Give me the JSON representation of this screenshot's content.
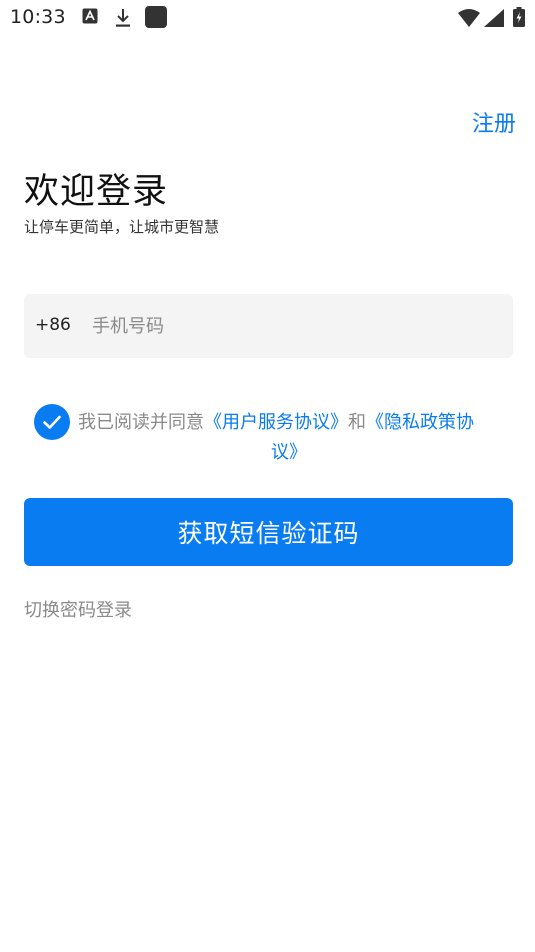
{
  "status_bar": {
    "time": "10:33",
    "icons": [
      "a-notification-icon",
      "download-icon",
      "app-icon",
      "wifi-icon",
      "signal-icon",
      "battery-icon"
    ]
  },
  "header": {
    "register_label": "注册"
  },
  "title": {
    "main": "欢迎登录",
    "subtitle": "让停车更简单，让城市更智慧"
  },
  "phone": {
    "country_code": "+86",
    "placeholder": "手机号码",
    "value": ""
  },
  "agreement": {
    "checked": true,
    "prefix": "我已阅读并同意",
    "user_agreement_part1": "《用户服务协议》",
    "and": "和",
    "privacy_part1": "《隐私政策协",
    "privacy_part2": "议》"
  },
  "actions": {
    "sms_button_label": "获取短信验证码",
    "switch_login_label": "切换密码登录"
  },
  "colors": {
    "accent": "#0a7cf2",
    "input_bg": "#f4f4f5",
    "muted_text": "#8a8a8a"
  }
}
